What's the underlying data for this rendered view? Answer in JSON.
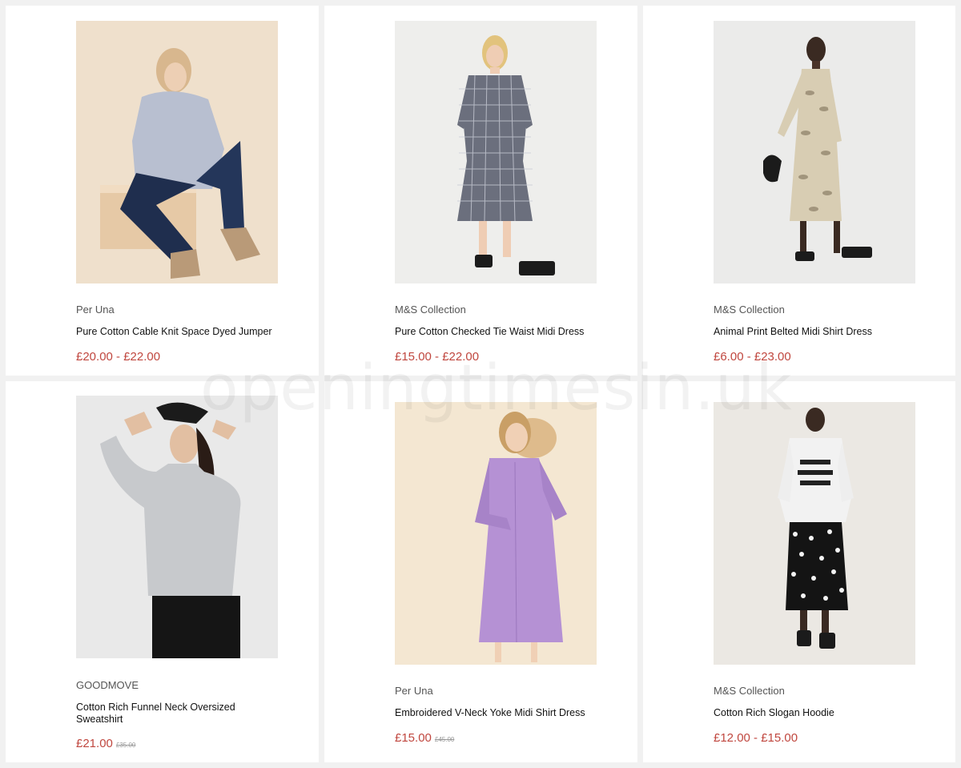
{
  "products": [
    {
      "brand": "Per Una",
      "title": "Pure Cotton Cable Knit Space Dyed Jumper",
      "price": "£20.00 - £22.00",
      "was": ""
    },
    {
      "brand": "M&S Collection",
      "title": "Pure Cotton Checked Tie Waist Midi Dress",
      "price": "£15.00 - £22.00",
      "was": ""
    },
    {
      "brand": "M&S Collection",
      "title": "Animal Print Belted Midi Shirt Dress",
      "price": "£6.00 - £23.00",
      "was": ""
    },
    {
      "brand": "GOODMOVE",
      "title": "Cotton Rich Funnel Neck Oversized Sweatshirt",
      "price": "£21.00",
      "was": "£35.00"
    },
    {
      "brand": "Per Una",
      "title": "Embroidered V-Neck Yoke Midi Shirt Dress",
      "price": "£15.00",
      "was": "£45.00"
    },
    {
      "brand": "M&S Collection",
      "title": "Cotton Rich Slogan Hoodie",
      "price": "£12.00 - £15.00",
      "was": ""
    }
  ],
  "watermark": "openingtimesin.uk",
  "colors": {
    "price": "#c0473f",
    "card": "#ffffff",
    "background": "#f1f1f1"
  }
}
